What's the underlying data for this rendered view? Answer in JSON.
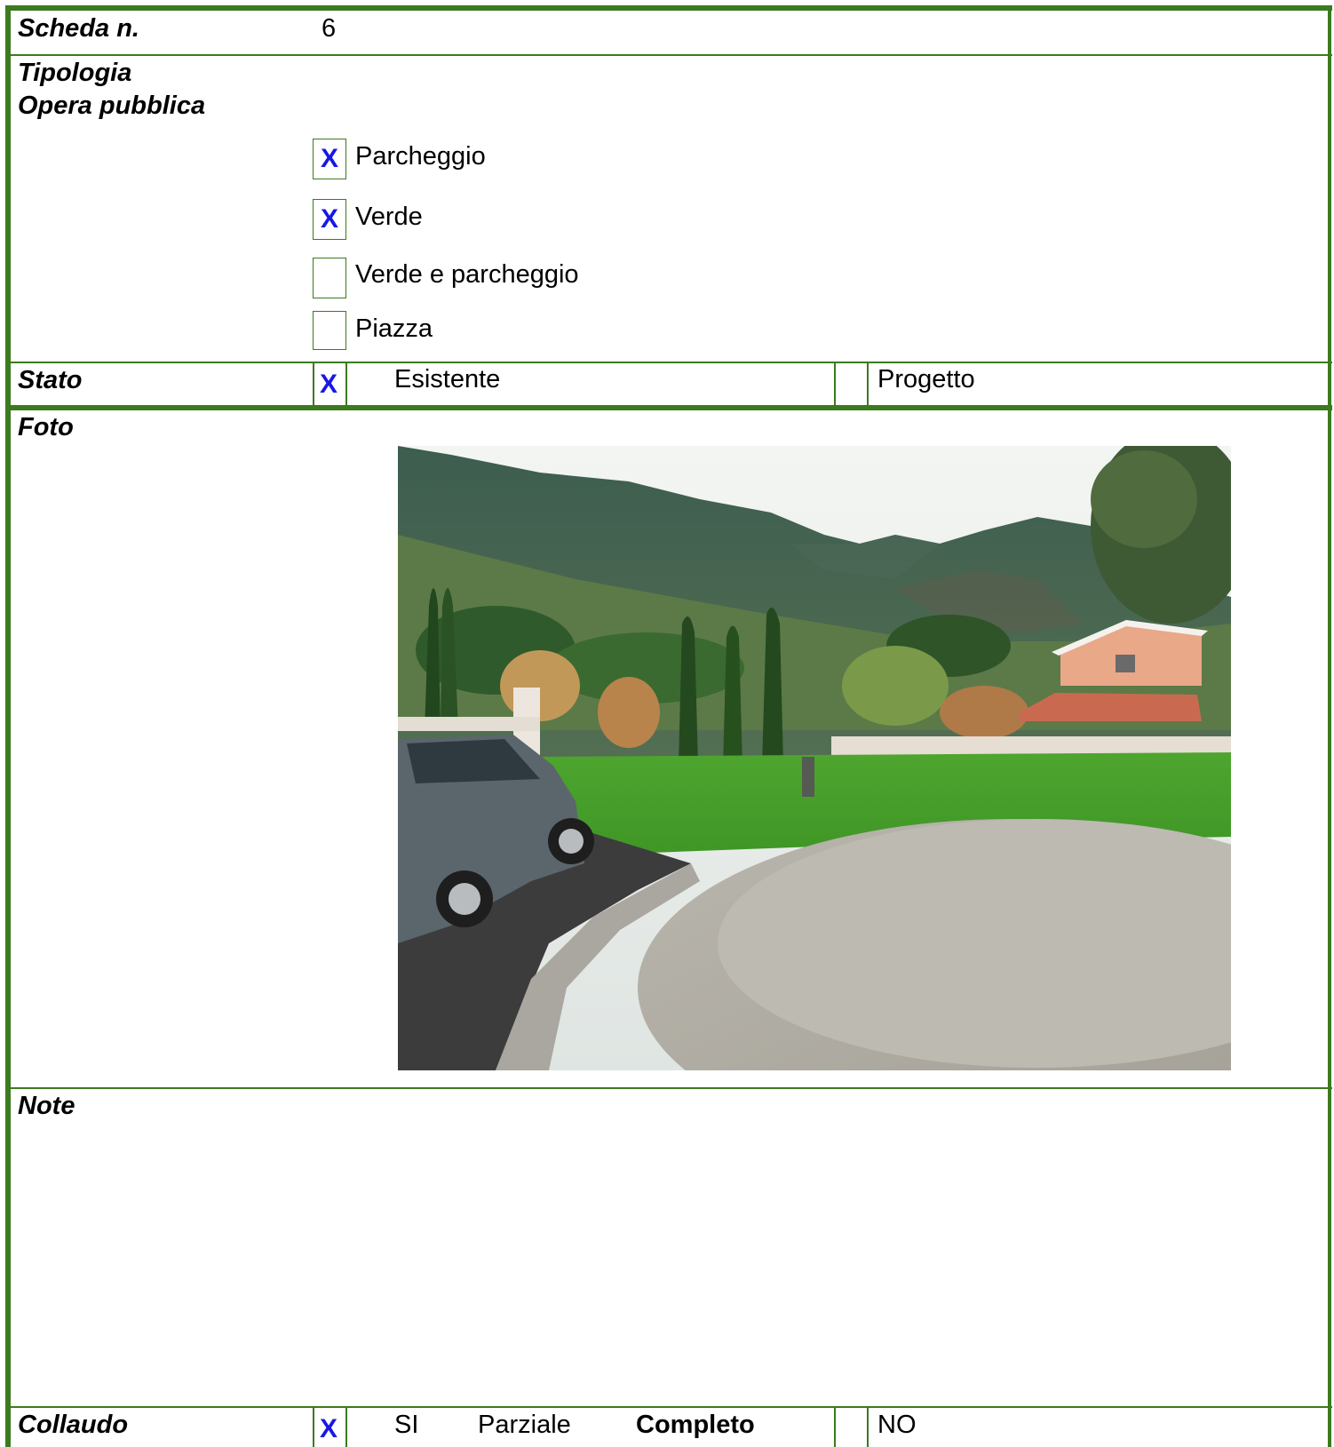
{
  "scheda": {
    "label": "Scheda n.",
    "value": "6"
  },
  "tipologia": {
    "label_line1": "Tipologia",
    "label_line2": "Opera pubblica",
    "options": [
      {
        "label": "Parcheggio",
        "checked": true,
        "mark": "X"
      },
      {
        "label": "Verde",
        "checked": true,
        "mark": "X"
      },
      {
        "label": "Verde e parcheggio",
        "checked": false,
        "mark": ""
      },
      {
        "label": "Piazza",
        "checked": false,
        "mark": ""
      }
    ]
  },
  "stato": {
    "label": "Stato",
    "mark": "X",
    "esistente": "Esistente",
    "progetto": "Progetto"
  },
  "foto": {
    "label": "Foto"
  },
  "note": {
    "label": "Note",
    "text": ""
  },
  "collaudo": {
    "label": "Collaudo",
    "mark": "X",
    "si": "SI",
    "parziale": "Parziale",
    "completo": "Completo",
    "no": "NO"
  },
  "colors": {
    "border": "#3c7a1e",
    "mark": "#1818e6"
  }
}
